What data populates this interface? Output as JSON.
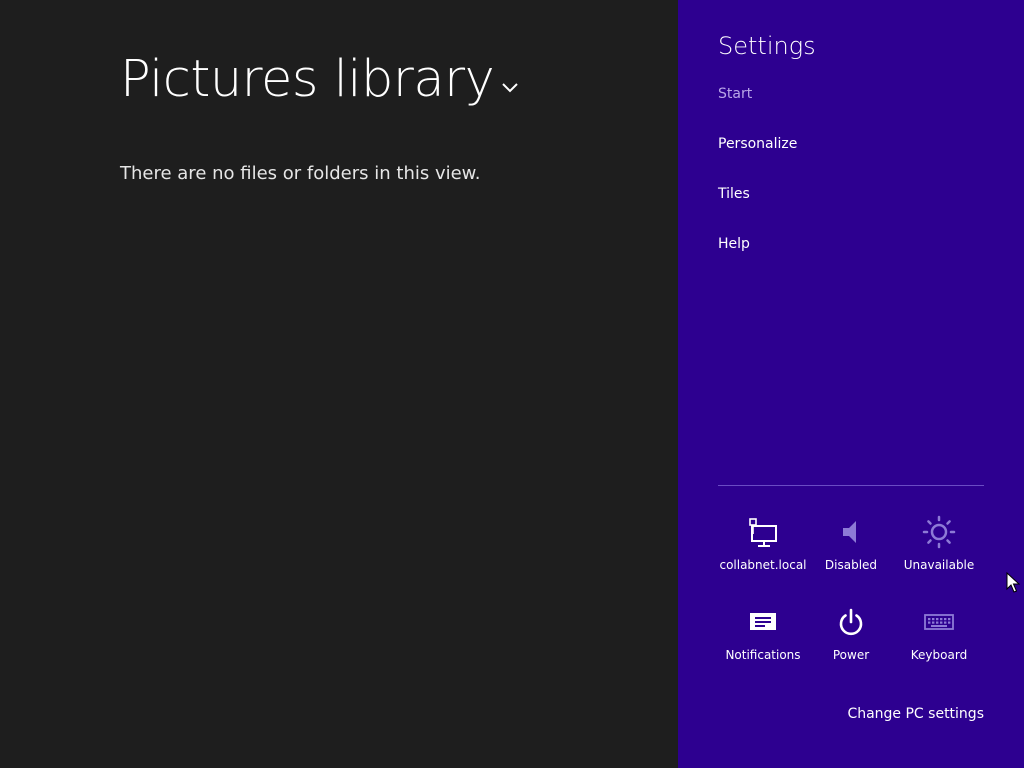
{
  "library": {
    "title": "Pictures library",
    "empty_message": "There are no files or folders in this view."
  },
  "settings": {
    "title": "Settings",
    "links": {
      "start": "Start",
      "personalize": "Personalize",
      "tiles": "Tiles",
      "help": "Help"
    },
    "quick_tiles": {
      "network": {
        "label": "collabnet.local",
        "icon": "network-icon"
      },
      "volume": {
        "label": "Disabled",
        "icon": "speaker-icon"
      },
      "brightness": {
        "label": "Unavailable",
        "icon": "brightness-icon"
      },
      "notifications": {
        "label": "Notifications",
        "icon": "notifications-icon"
      },
      "power": {
        "label": "Power",
        "icon": "power-icon"
      },
      "keyboard": {
        "label": "Keyboard",
        "icon": "keyboard-icon"
      }
    },
    "change_pc_settings": "Change PC settings"
  },
  "colors": {
    "desktop_bg": "#1e1e1e",
    "charm_bg": "#2d0090",
    "dim_text": "#b9a6e8",
    "disabled_icon": "#8d7ad6"
  }
}
